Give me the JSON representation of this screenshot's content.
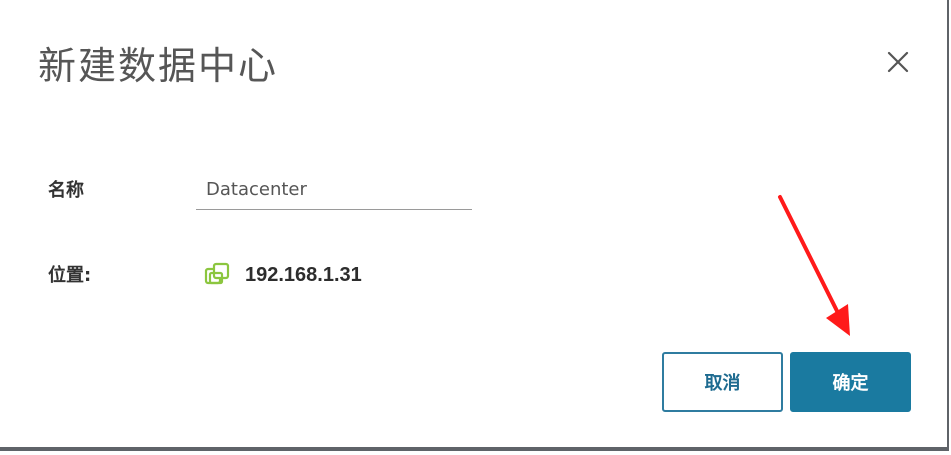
{
  "dialog": {
    "title": "新建数据中心",
    "close_icon": "close-icon"
  },
  "form": {
    "name_label": "名称",
    "name_value": "Datacenter",
    "location_label": "位置:",
    "location_icon": "host-icon",
    "location_value": "192.168.1.31"
  },
  "buttons": {
    "cancel_label": "取消",
    "ok_label": "确定"
  },
  "colors": {
    "primary": "#1a7aa0",
    "host_icon": "#8cc63f",
    "annotation_arrow": "#ff1a1a"
  }
}
